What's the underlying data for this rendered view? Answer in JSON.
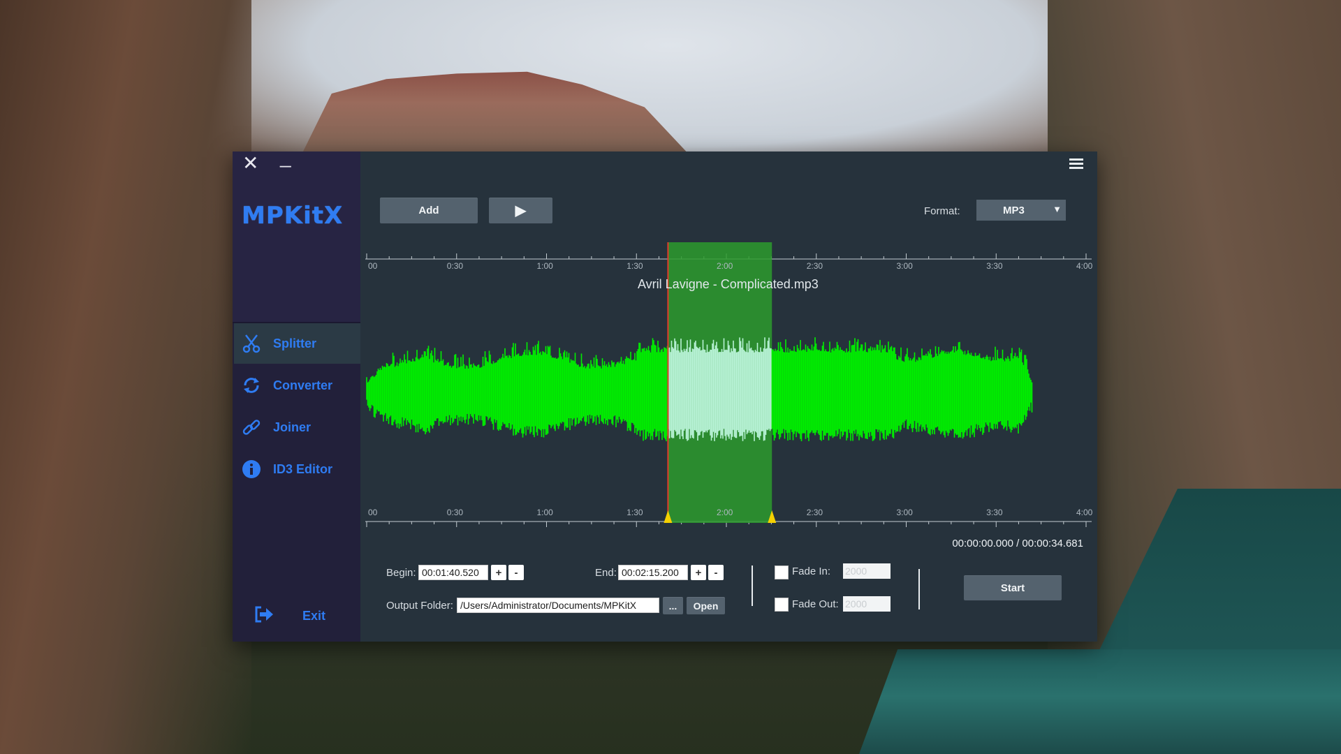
{
  "app": {
    "logo_text": "MPKitX",
    "accent_color": "#2f7cf2",
    "close_glyph": "✕",
    "minimize_glyph": "_"
  },
  "sidebar": {
    "items": [
      {
        "label": "Splitter",
        "icon": "scissors-icon",
        "active": true
      },
      {
        "label": "Converter",
        "icon": "refresh-icon",
        "active": false
      },
      {
        "label": "Joiner",
        "icon": "link-icon",
        "active": false
      },
      {
        "label": "ID3 Editor",
        "icon": "info-icon",
        "active": false
      }
    ],
    "exit_label": "Exit"
  },
  "toolbar": {
    "add_label": "Add",
    "play_glyph": "▶",
    "format_label": "Format:",
    "format_value": "MP3",
    "format_arrow": "▼"
  },
  "waveform": {
    "track_title": "Avril Lavigne - Complicated.mp3",
    "ruler_labels": [
      "00",
      "0:30",
      "1:00",
      "1:30",
      "2:00",
      "2:30",
      "3:00",
      "3:30",
      "4:00"
    ],
    "waveform_color": "#00f000",
    "selection_color": "#2d9b2d",
    "selection_start_seconds": 100.52,
    "selection_end_seconds": 135.2,
    "time_readout": "00:00:00.000 / 00:00:34.681"
  },
  "controls": {
    "begin_label": "Begin:",
    "begin_value": "00:01:40.520",
    "end_label": "End:",
    "end_value": "00:02:15.200",
    "plus_glyph": "+",
    "minus_glyph": "-",
    "output_label": "Output Folder:",
    "output_value": "/Users/Administrator/Documents/MPKitX",
    "browse_label": "...",
    "open_label": "Open",
    "fade_in_label": "Fade In:",
    "fade_in_value": "2000",
    "fade_out_label": "Fade Out:",
    "fade_out_value": "2000",
    "start_label": "Start"
  }
}
